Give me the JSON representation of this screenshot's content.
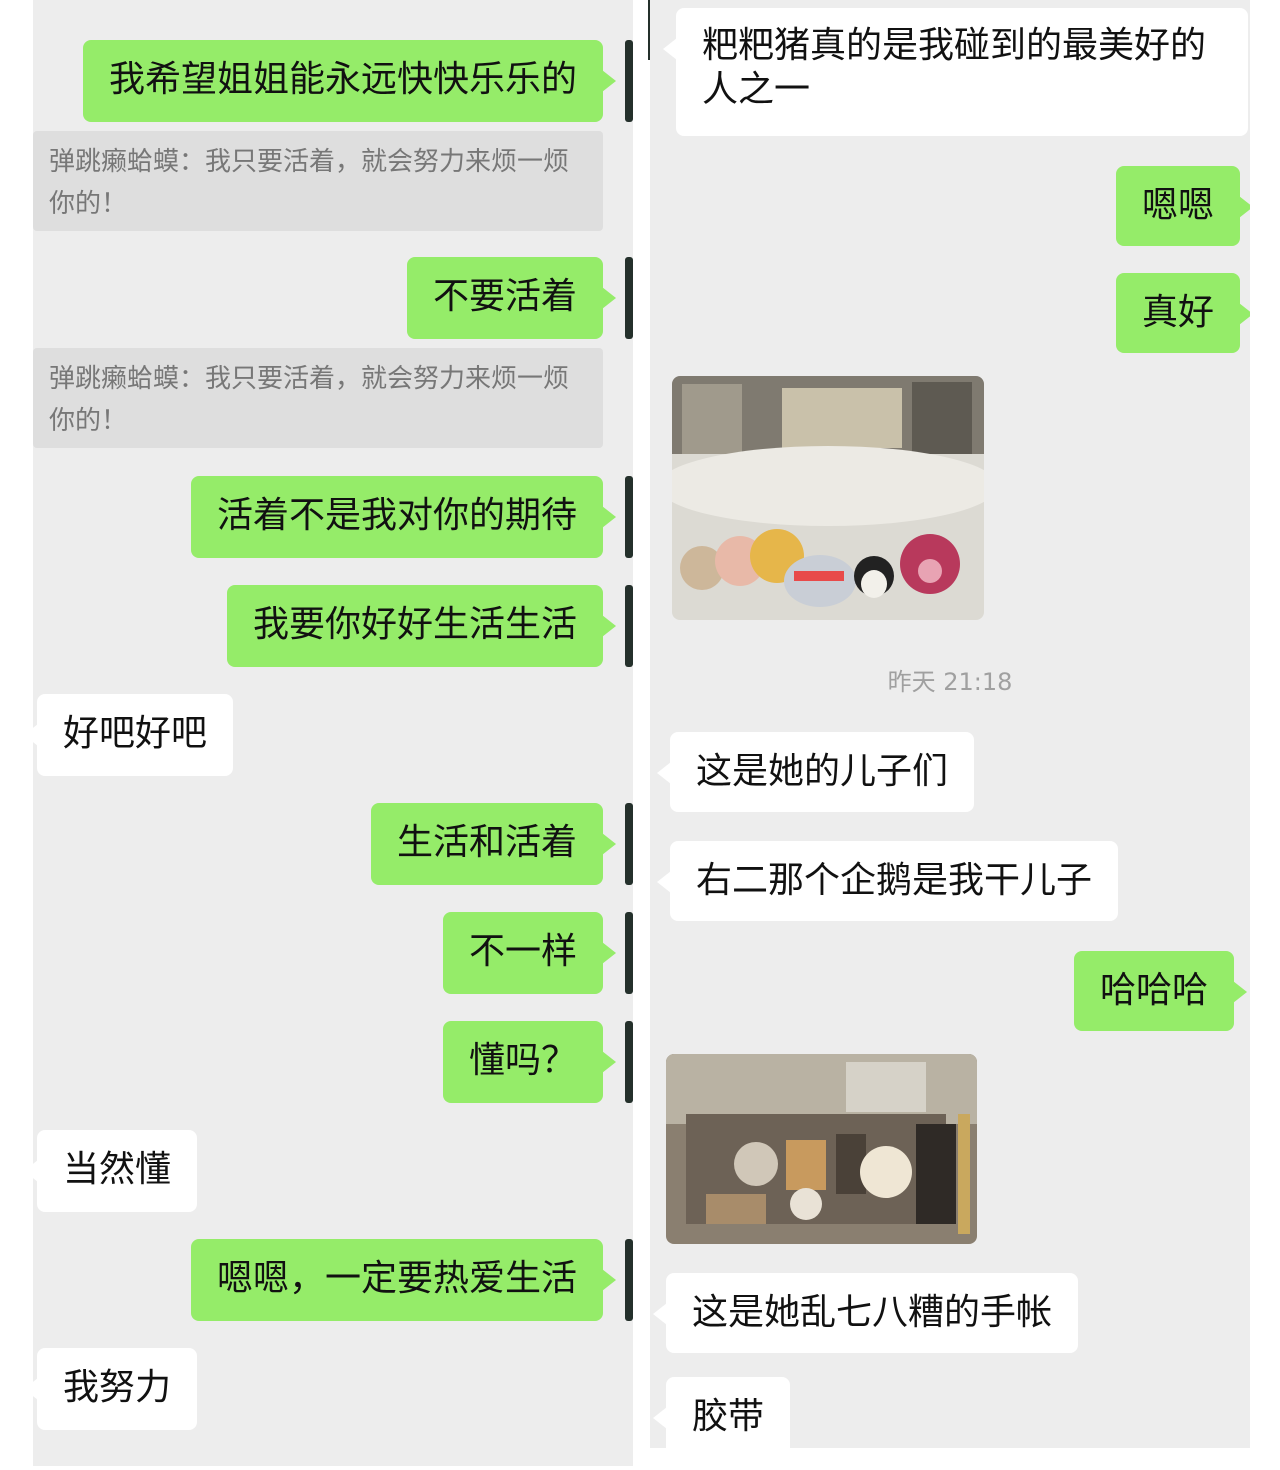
{
  "left": {
    "msg1": "我希望姐姐能永远快快乐乐的",
    "quote1": "弹跳癞蛤蟆：我只要活着，就会努力来烦一烦你的！",
    "msg2": "不要活着",
    "quote2": "弹跳癞蛤蟆：我只要活着，就会努力来烦一烦你的！",
    "msg3": "活着不是我对你的期待",
    "msg4": "我要你好好生活生活",
    "msg5": "好吧好吧",
    "msg6": "生活和活着",
    "msg7": "不一样",
    "msg8": "懂吗？",
    "msg9": "当然懂",
    "msg10": "嗯嗯，一定要热爱生活",
    "msg11": "我努力"
  },
  "right": {
    "msg1": "粑粑猪真的是我碰到的最美好的人之一",
    "msg2": "嗯嗯",
    "msg3": "真好",
    "timestamp": "昨天 21:18",
    "msg4": "这是她的儿子们",
    "msg5": "右二那个企鹅是我干儿子",
    "msg6": "哈哈哈",
    "msg7": "这是她乱七八糟的手帐",
    "msg8": "胶带"
  },
  "colors": {
    "sent": "#95ec69",
    "received": "#ffffff",
    "background": "#ededed"
  }
}
